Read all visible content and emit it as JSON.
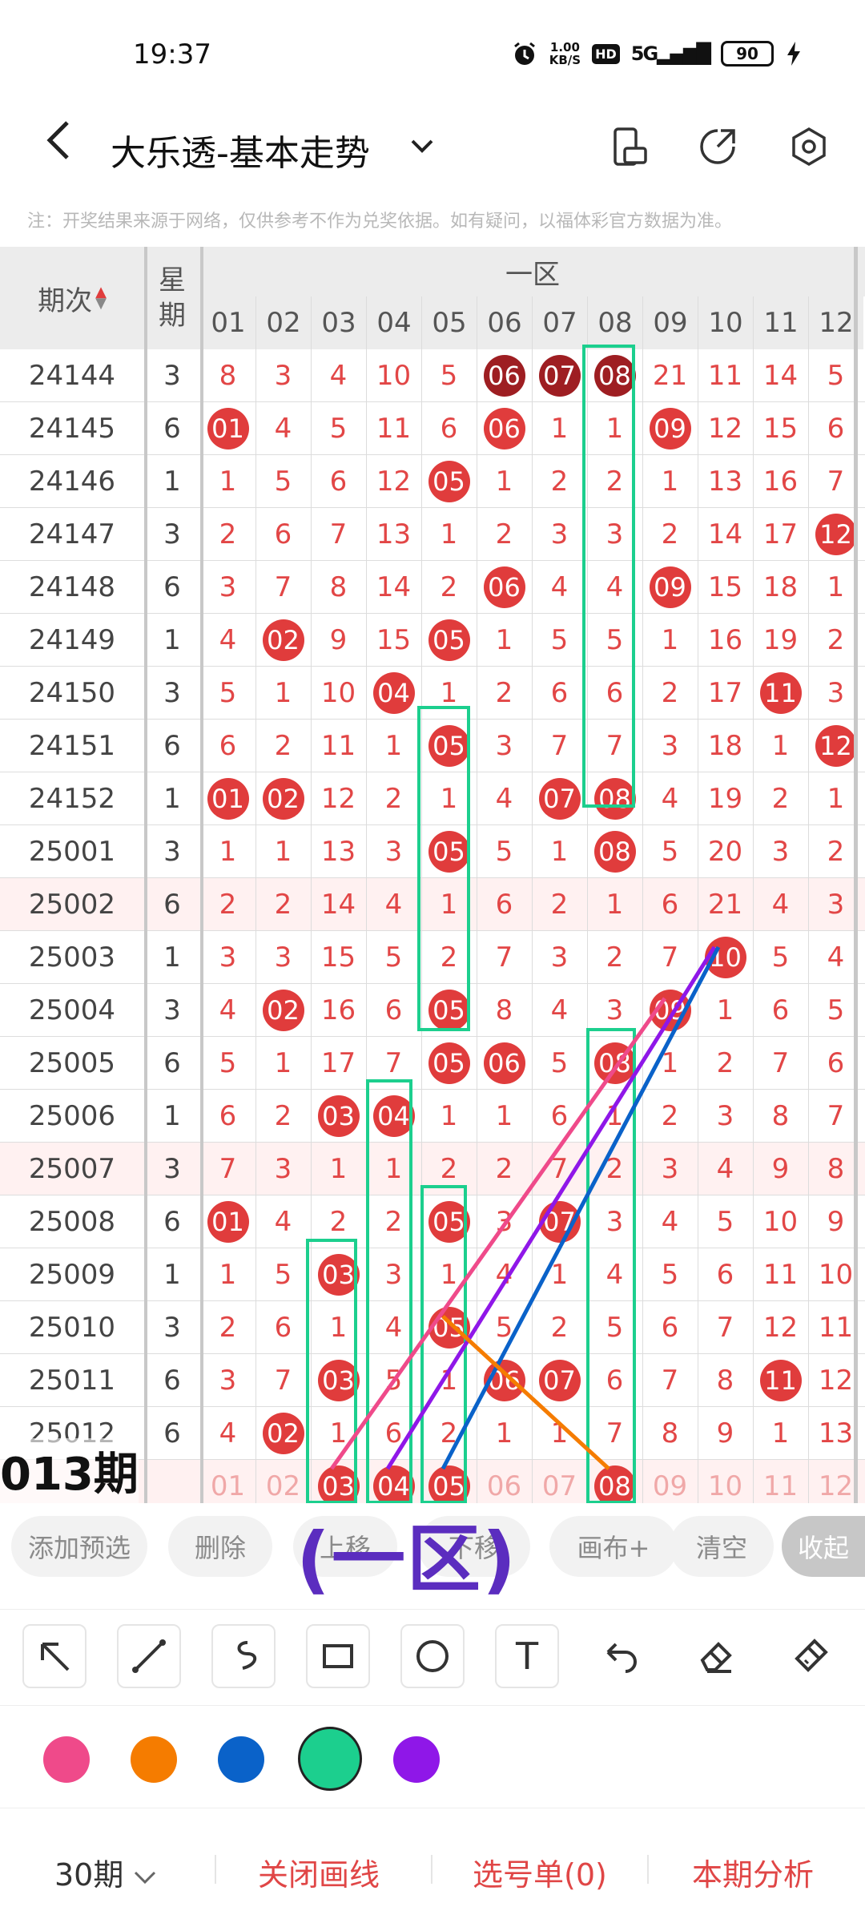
{
  "status_bar": {
    "time": "19:37",
    "speed": "1.00",
    "speed_unit": "KB/S",
    "hd": "HD",
    "network": "5G",
    "battery": "90"
  },
  "header": {
    "title": "大乐透-基本走势"
  },
  "note": "注：开奖结果来源于网络，仅供参考不作为兑奖依据。如有疑问，以福体彩官方数据为准。",
  "table": {
    "col_issue": "期次",
    "col_week": "星期",
    "zone_label": "一区",
    "numbers": [
      "01",
      "02",
      "03",
      "04",
      "05",
      "06",
      "07",
      "08",
      "09",
      "10",
      "11",
      "12"
    ],
    "rows": [
      {
        "issue": "24144",
        "week": "3",
        "cells": [
          "8",
          "3",
          "4",
          "10",
          "5",
          "06",
          "07",
          "08",
          "21",
          "11",
          "14",
          "5"
        ],
        "hits": [
          6,
          7,
          8
        ]
      },
      {
        "issue": "24145",
        "week": "6",
        "cells": [
          "01",
          "4",
          "5",
          "11",
          "6",
          "06",
          "1",
          "1",
          "09",
          "12",
          "15",
          "6"
        ],
        "hits": [
          1,
          6,
          9
        ]
      },
      {
        "issue": "24146",
        "week": "1",
        "cells": [
          "1",
          "5",
          "6",
          "12",
          "05",
          "1",
          "2",
          "2",
          "1",
          "13",
          "16",
          "7"
        ],
        "hits": [
          5
        ]
      },
      {
        "issue": "24147",
        "week": "3",
        "cells": [
          "2",
          "6",
          "7",
          "13",
          "1",
          "2",
          "3",
          "3",
          "2",
          "14",
          "17",
          "12"
        ],
        "hits": [
          12
        ]
      },
      {
        "issue": "24148",
        "week": "6",
        "cells": [
          "3",
          "7",
          "8",
          "14",
          "2",
          "06",
          "4",
          "4",
          "09",
          "15",
          "18",
          "1"
        ],
        "hits": [
          6,
          9
        ]
      },
      {
        "issue": "24149",
        "week": "1",
        "cells": [
          "4",
          "02",
          "9",
          "15",
          "05",
          "1",
          "5",
          "5",
          "1",
          "16",
          "19",
          "2"
        ],
        "hits": [
          2,
          5
        ]
      },
      {
        "issue": "24150",
        "week": "3",
        "cells": [
          "5",
          "1",
          "10",
          "04",
          "1",
          "2",
          "6",
          "6",
          "2",
          "17",
          "11",
          "3"
        ],
        "hits": [
          4,
          11
        ]
      },
      {
        "issue": "24151",
        "week": "6",
        "cells": [
          "6",
          "2",
          "11",
          "1",
          "05",
          "3",
          "7",
          "7",
          "3",
          "18",
          "1",
          "12"
        ],
        "hits": [
          5,
          12
        ]
      },
      {
        "issue": "24152",
        "week": "1",
        "cells": [
          "01",
          "02",
          "12",
          "2",
          "1",
          "4",
          "07",
          "08",
          "4",
          "19",
          "2",
          "1"
        ],
        "hits": [
          1,
          2,
          7,
          8
        ]
      },
      {
        "issue": "25001",
        "week": "3",
        "cells": [
          "1",
          "1",
          "13",
          "3",
          "05",
          "5",
          "1",
          "08",
          "5",
          "20",
          "3",
          "2"
        ],
        "hits": [
          5,
          8
        ]
      },
      {
        "issue": "25002",
        "week": "6",
        "cells": [
          "2",
          "2",
          "14",
          "4",
          "1",
          "6",
          "2",
          "1",
          "6",
          "21",
          "4",
          "3"
        ],
        "hits": []
      },
      {
        "issue": "25003",
        "week": "1",
        "cells": [
          "3",
          "3",
          "15",
          "5",
          "2",
          "7",
          "3",
          "2",
          "7",
          "10",
          "5",
          "4"
        ],
        "hits": [
          10
        ]
      },
      {
        "issue": "25004",
        "week": "3",
        "cells": [
          "4",
          "02",
          "16",
          "6",
          "05",
          "8",
          "4",
          "3",
          "09",
          "1",
          "6",
          "5"
        ],
        "hits": [
          2,
          5,
          9
        ]
      },
      {
        "issue": "25005",
        "week": "6",
        "cells": [
          "5",
          "1",
          "17",
          "7",
          "05",
          "06",
          "5",
          "08",
          "1",
          "2",
          "7",
          "6"
        ],
        "hits": [
          5,
          6,
          8
        ]
      },
      {
        "issue": "25006",
        "week": "1",
        "cells": [
          "6",
          "2",
          "03",
          "04",
          "1",
          "1",
          "6",
          "1",
          "2",
          "3",
          "8",
          "7"
        ],
        "hits": [
          3,
          4
        ]
      },
      {
        "issue": "25007",
        "week": "3",
        "cells": [
          "7",
          "3",
          "1",
          "1",
          "2",
          "2",
          "7",
          "2",
          "3",
          "4",
          "9",
          "8"
        ],
        "hits": []
      },
      {
        "issue": "25008",
        "week": "6",
        "cells": [
          "01",
          "4",
          "2",
          "2",
          "05",
          "3",
          "07",
          "3",
          "4",
          "5",
          "10",
          "9"
        ],
        "hits": [
          1,
          5,
          7
        ]
      },
      {
        "issue": "25009",
        "week": "1",
        "cells": [
          "1",
          "5",
          "03",
          "3",
          "1",
          "4",
          "1",
          "4",
          "5",
          "6",
          "11",
          "10"
        ],
        "hits": [
          3
        ]
      },
      {
        "issue": "25010",
        "week": "3",
        "cells": [
          "2",
          "6",
          "1",
          "4",
          "05",
          "5",
          "2",
          "5",
          "6",
          "7",
          "12",
          "11"
        ],
        "hits": [
          5
        ]
      },
      {
        "issue": "25011",
        "week": "6",
        "cells": [
          "3",
          "7",
          "03",
          "5",
          "1",
          "06",
          "07",
          "6",
          "7",
          "8",
          "11",
          "12"
        ],
        "hits": [
          3,
          6,
          7,
          11
        ]
      },
      {
        "issue": "25012",
        "week": "6",
        "cells": [
          "4",
          "02",
          "1",
          "6",
          "2",
          "1",
          "1",
          "7",
          "8",
          "9",
          "1",
          "13"
        ],
        "hits": [
          2
        ]
      }
    ],
    "predict_row": {
      "cells": [
        "01",
        "02",
        "03",
        "04",
        "05",
        "06",
        "07",
        "08",
        "09",
        "10",
        "11",
        "12"
      ],
      "hits": [
        3,
        4,
        5,
        8
      ]
    }
  },
  "issue_tip": "013期",
  "toolbar": {
    "add": "添加预选",
    "delete": "删除",
    "move_up": "上移",
    "move_down": "下移",
    "canvas": "画布+",
    "clear": "清空",
    "collapse": "收起"
  },
  "zone_annotation": "(一区)",
  "tools": {
    "text_tool": "T"
  },
  "colors": {
    "pink": "#ef4a8a",
    "orange": "#f57c00",
    "blue": "#0a62c9",
    "green": "#1ccf8e",
    "purple": "#8f17e8"
  },
  "bottom": {
    "period": "30期",
    "close_draw": "关闭画线",
    "selection": "选号单(0)",
    "analysis": "本期分析"
  }
}
